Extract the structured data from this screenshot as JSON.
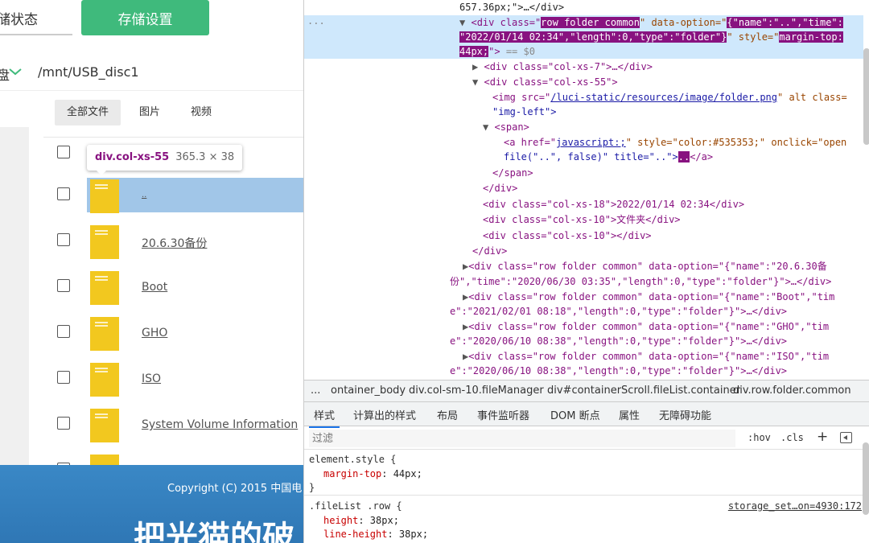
{
  "page": {
    "tab_status": "储状态",
    "save_button": "存储设置",
    "disk_label": "盘",
    "path": "/mnt/USB_disc1",
    "file_tabs": [
      "全部文件",
      "图片",
      "视频"
    ],
    "files": [
      {
        "name": ".."
      },
      {
        "name": "20.6.30备份"
      },
      {
        "name": "Boot"
      },
      {
        "name": "GHO"
      },
      {
        "name": "ISO"
      },
      {
        "name": "System Volume Information"
      },
      {
        "name": "...."
      }
    ],
    "tooltip": {
      "name": "div.col-xs-55",
      "size": "365.3 × 38"
    },
    "footer": {
      "copyright": "Copyright (C) 2015 中国电",
      "big_title": "把光猫的破"
    }
  },
  "devtools": {
    "elements": {
      "l0": "657.36px;\">…</div>",
      "l1_tag": "<div class=\"",
      "l1_class": "row folder common",
      "l1_mid": "\" data-option=\"",
      "l1_opt": "{\"name\":\"..\",\"time\":",
      "l2_opt": "\"2022/01/14 02:34\",\"length\":0,\"type\":\"folder\"}",
      "l2_style_attr": "\" style=\"",
      "l2_style": "margin-top:",
      "l3_style": "44px;",
      "l3_end": "\">",
      "l3_eq": "== $0",
      "l4": "<div class=\"col-xs-7\">…</div>",
      "l5": "<div class=\"col-xs-55\">",
      "l6_a": "<img src=\"",
      "l6_link": "/luci-static/resources/image/folder.png",
      "l6_b": "\" alt class=",
      "l7": "\"img-left\">",
      "l8": "<span>",
      "l9_a": "<a href=\"",
      "l9_link": "javascript:;",
      "l9_b": "\" style=\"color:#535353;\" onclick=\"open",
      "l10_a": "file(\"..\", false)\" title=\"..\">",
      "l10_mark": "..",
      "l10_b": "</a>",
      "l11": "</span>",
      "l12": "</div>",
      "l13": "<div class=\"col-xs-18\">2022/01/14 02:34</div>",
      "l14": "<div class=\"col-xs-10\">文件夹</div>",
      "l15": "<div class=\"col-xs-10\"></div>",
      "l16": "</div>",
      "l17": "<div class=\"row folder common\" data-option=\"{\"name\":\"20.6.30备",
      "l18": "份\",\"time\":\"2020/06/30 03:35\",\"length\":0,\"type\":\"folder\"}\">…</div>",
      "l19": "<div class=\"row folder common\" data-option=\"{\"name\":\"Boot\",\"tim",
      "l20": "e\":\"2021/02/01 08:18\",\"length\":0,\"type\":\"folder\"}\">…</div>",
      "l21": "<div class=\"row folder common\" data-option=\"{\"name\":\"GHO\",\"tim",
      "l22": "e\":\"2020/06/10 08:38\",\"length\":0,\"type\":\"folder\"}\">…</div>",
      "l23": "<div class=\"row folder common\" data-option=\"{\"name\":\"ISO\",\"tim",
      "l24": "e\":\"2020/06/10 08:38\",\"length\":0,\"type\":\"folder\"}\">…</div>",
      "gutter_dots": "..."
    },
    "breadcrumbs": [
      "...",
      "ontainer_body",
      "div.col-sm-10.fileManager",
      "div#containerScroll.fileList.container",
      "div.row.folder.common"
    ],
    "style_tabs": [
      "样式",
      "计算出的样式",
      "布局",
      "事件监听器",
      "DOM 断点",
      "属性",
      "无障碍功能"
    ],
    "filter": {
      "placeholder": "过滤",
      "hov": ":hov",
      "cls": ".cls",
      "plus": "+"
    },
    "styles": {
      "s1": "element.style {",
      "s2_prop": "margin-top",
      "s2_val": ": 44px;",
      "s3": "}",
      "s4": ".fileList .row {",
      "s4_src": "storage_set…on=4930:172",
      "s5_prop": "height",
      "s5_val": ": 38px;",
      "s6_prop": "line-height",
      "s6_val": ": 38px;"
    }
  },
  "colors": {
    "accent_green": "#3fba7c",
    "folder_yellow": "#f2c81f",
    "select_blue": "#cfe8fc",
    "footer_blue": "#3a88c6"
  }
}
